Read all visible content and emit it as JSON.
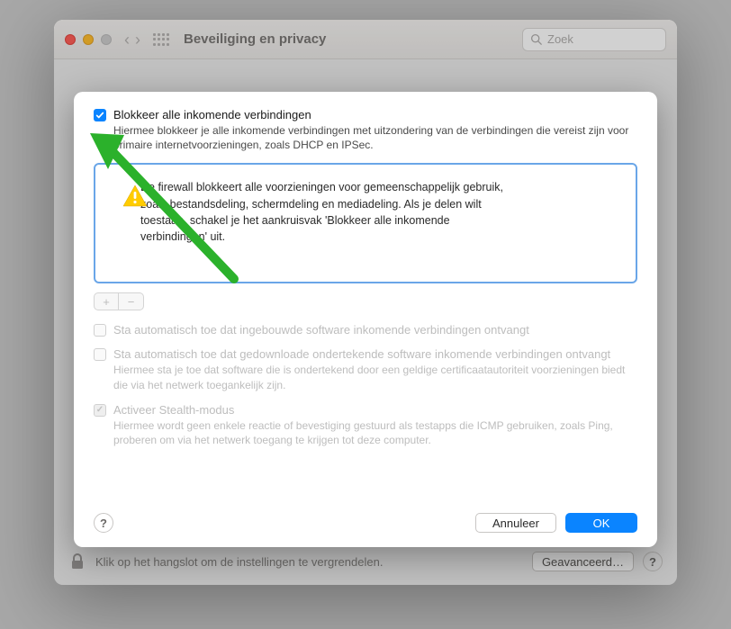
{
  "window": {
    "title": "Beveiliging en privacy",
    "search_placeholder": "Zoek"
  },
  "sheet": {
    "blockAll": {
      "label": "Blokkeer alle inkomende verbindingen",
      "desc": "Hiermee blokkeer je alle inkomende verbindingen met uitzondering van de verbindingen die vereist zijn voor primaire internetvoorzieningen, zoals DHCP en IPSec."
    },
    "info": "De firewall blokkeert alle voorzieningen voor gemeenschappelijk gebruik, zoals bestandsdeling, schermdeling en mediadeling. Als je delen wilt toestaan, schakel je het aankruisvak 'Blokkeer alle inkomende verbindingen' uit.",
    "segPlus": "+",
    "segMinus": "−",
    "autoBuiltIn": {
      "label": "Sta automatisch toe dat ingebouwde software inkomende verbindingen ontvangt"
    },
    "autoSigned": {
      "label": "Sta automatisch toe dat gedownloade ondertekende software inkomende verbindingen ontvangt",
      "desc": "Hiermee sta je toe dat software die is ondertekend door een geldige certificaatautoriteit voorzieningen biedt die via het netwerk toegankelijk zijn."
    },
    "stealth": {
      "label": "Activeer Stealth-modus",
      "desc": "Hiermee wordt geen enkele reactie of bevestiging gestuurd als testapps die ICMP gebruiken, zoals Ping, proberen om via het netwerk toegang te krijgen tot deze computer."
    },
    "help": "?",
    "cancel": "Annuleer",
    "ok": "OK"
  },
  "bottom": {
    "lockText": "Klik op het hangslot om de instellingen te vergrendelen.",
    "advanced": "Geavanceerd…",
    "help": "?"
  }
}
